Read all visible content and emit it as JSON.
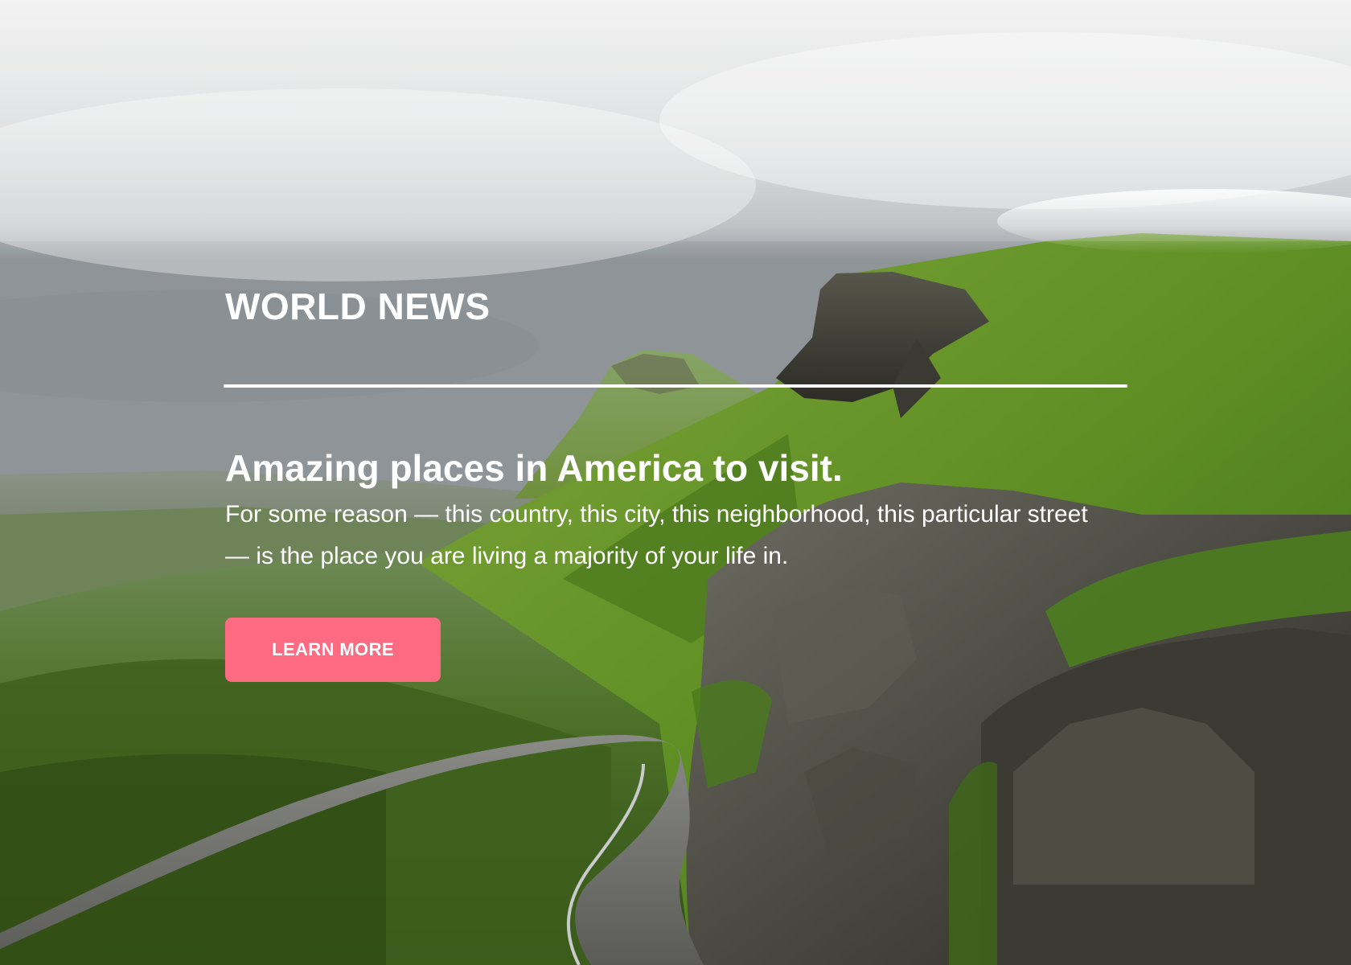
{
  "brand": {
    "title": "WORLD NEWS"
  },
  "article": {
    "headline": "Amazing places in America to visit.",
    "lead": "For some reason — this country, this city, this neighborhood, this particular street — is the place you are living a majority of your life in."
  },
  "cta": {
    "label": "LEARN MORE"
  },
  "colors": {
    "accent": "#fd6a82",
    "text": "#ffffff",
    "sky": "#d8dadb",
    "grass": "#5e8f2a",
    "rock": "#3b3a34"
  },
  "background": {
    "icon": "mountain-landscape-image"
  }
}
